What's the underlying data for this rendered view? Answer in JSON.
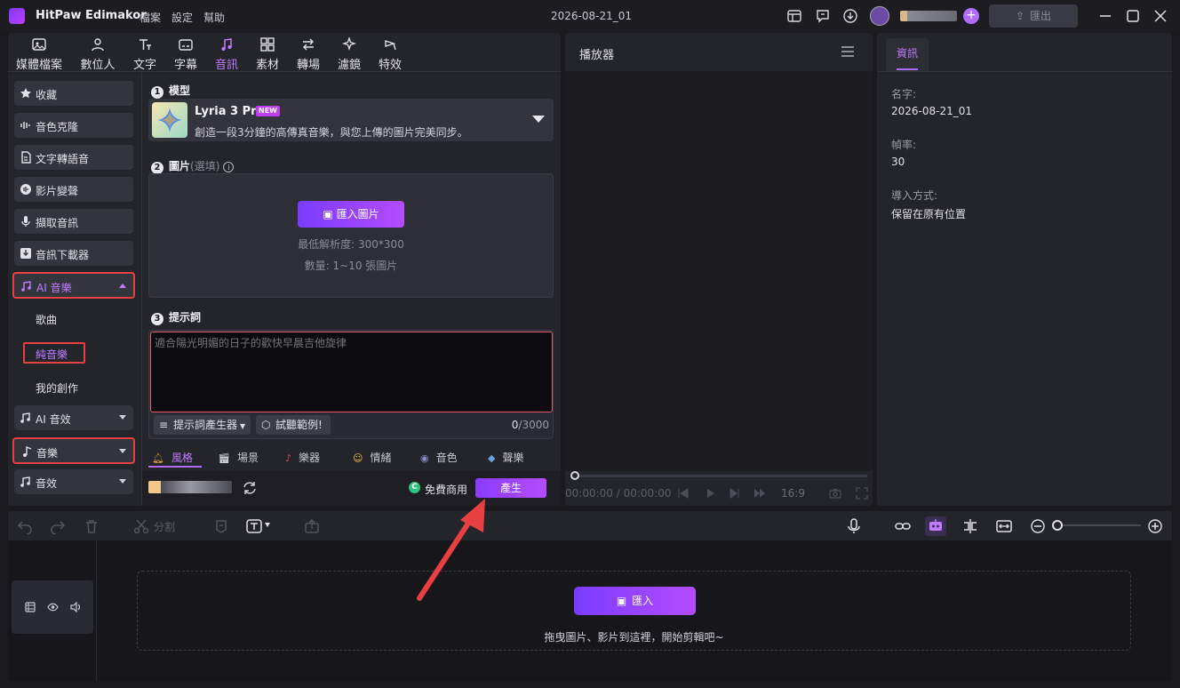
{
  "app": {
    "name": "HitPaw Edimakor",
    "project_title": "2026-08-21_01",
    "export_label": "匯出"
  },
  "menu": [
    "檔案",
    "設定",
    "幫助"
  ],
  "category_tabs": [
    {
      "label": "媒體檔案",
      "icon": "media-icon"
    },
    {
      "label": "數位人",
      "icon": "avatar-icon"
    },
    {
      "label": "文字",
      "icon": "text-icon"
    },
    {
      "label": "字幕",
      "icon": "subtitle-icon"
    },
    {
      "label": "音訊",
      "icon": "audio-icon"
    },
    {
      "label": "素材",
      "icon": "elements-icon"
    },
    {
      "label": "轉場",
      "icon": "transition-icon"
    },
    {
      "label": "濾鏡",
      "icon": "filter-icon"
    },
    {
      "label": "特效",
      "icon": "effects-icon"
    }
  ],
  "sidebar": {
    "items": [
      "收藏",
      "音色克隆",
      "文字轉語音",
      "影片變聲",
      "擷取音訊",
      "音訊下載器",
      "AI 音樂",
      "AI 音效",
      "音樂",
      "音效"
    ],
    "sub_items": [
      "歌曲",
      "純音樂",
      "我的創作"
    ]
  },
  "form": {
    "model_title": "模型",
    "model_name": "Lyria 3 Pro",
    "new_badge": "NEW",
    "model_desc": "創造一段3分鐘的高傳真音樂，與您上傳的圖片完美同步。",
    "image_title": "圖片",
    "image_optional": "(選填)",
    "import_image_label": "匯入圖片",
    "min_resolution": "最低解析度:  300*300",
    "count_hint": "數量:  1~10 張圖片",
    "prompt_title": "提示詞",
    "prompt_placeholder": "適合陽光明媚的日子的歡快早晨吉他旋律",
    "prompt_generator": "提示詞產生器",
    "try_example": "試聽範例!",
    "char_count": "0",
    "char_max": "/3000",
    "style_tabs": [
      "風格",
      "場景",
      "樂器",
      "情緒",
      "音色",
      "聲樂"
    ],
    "free_label": "免費商用",
    "free_badge": "C",
    "generate_label": "產生"
  },
  "player": {
    "title": "播放器",
    "timecode": "00:00:00 / 00:00:00",
    "ratio": "16:9"
  },
  "info": {
    "tab": "資訊",
    "fields": [
      {
        "label": "名字:",
        "value": "2026-08-21_01"
      },
      {
        "label": "幀率:",
        "value": "30"
      },
      {
        "label": "導入方式:",
        "value": "保留在原有位置"
      }
    ]
  },
  "timeline": {
    "split_label": "分割",
    "import_label": "匯入",
    "drop_hint": "拖曳圖片、影片到這裡，開始剪輯吧~"
  },
  "colors": {
    "accent": "#b06cff",
    "highlight_box": "#e84040"
  }
}
